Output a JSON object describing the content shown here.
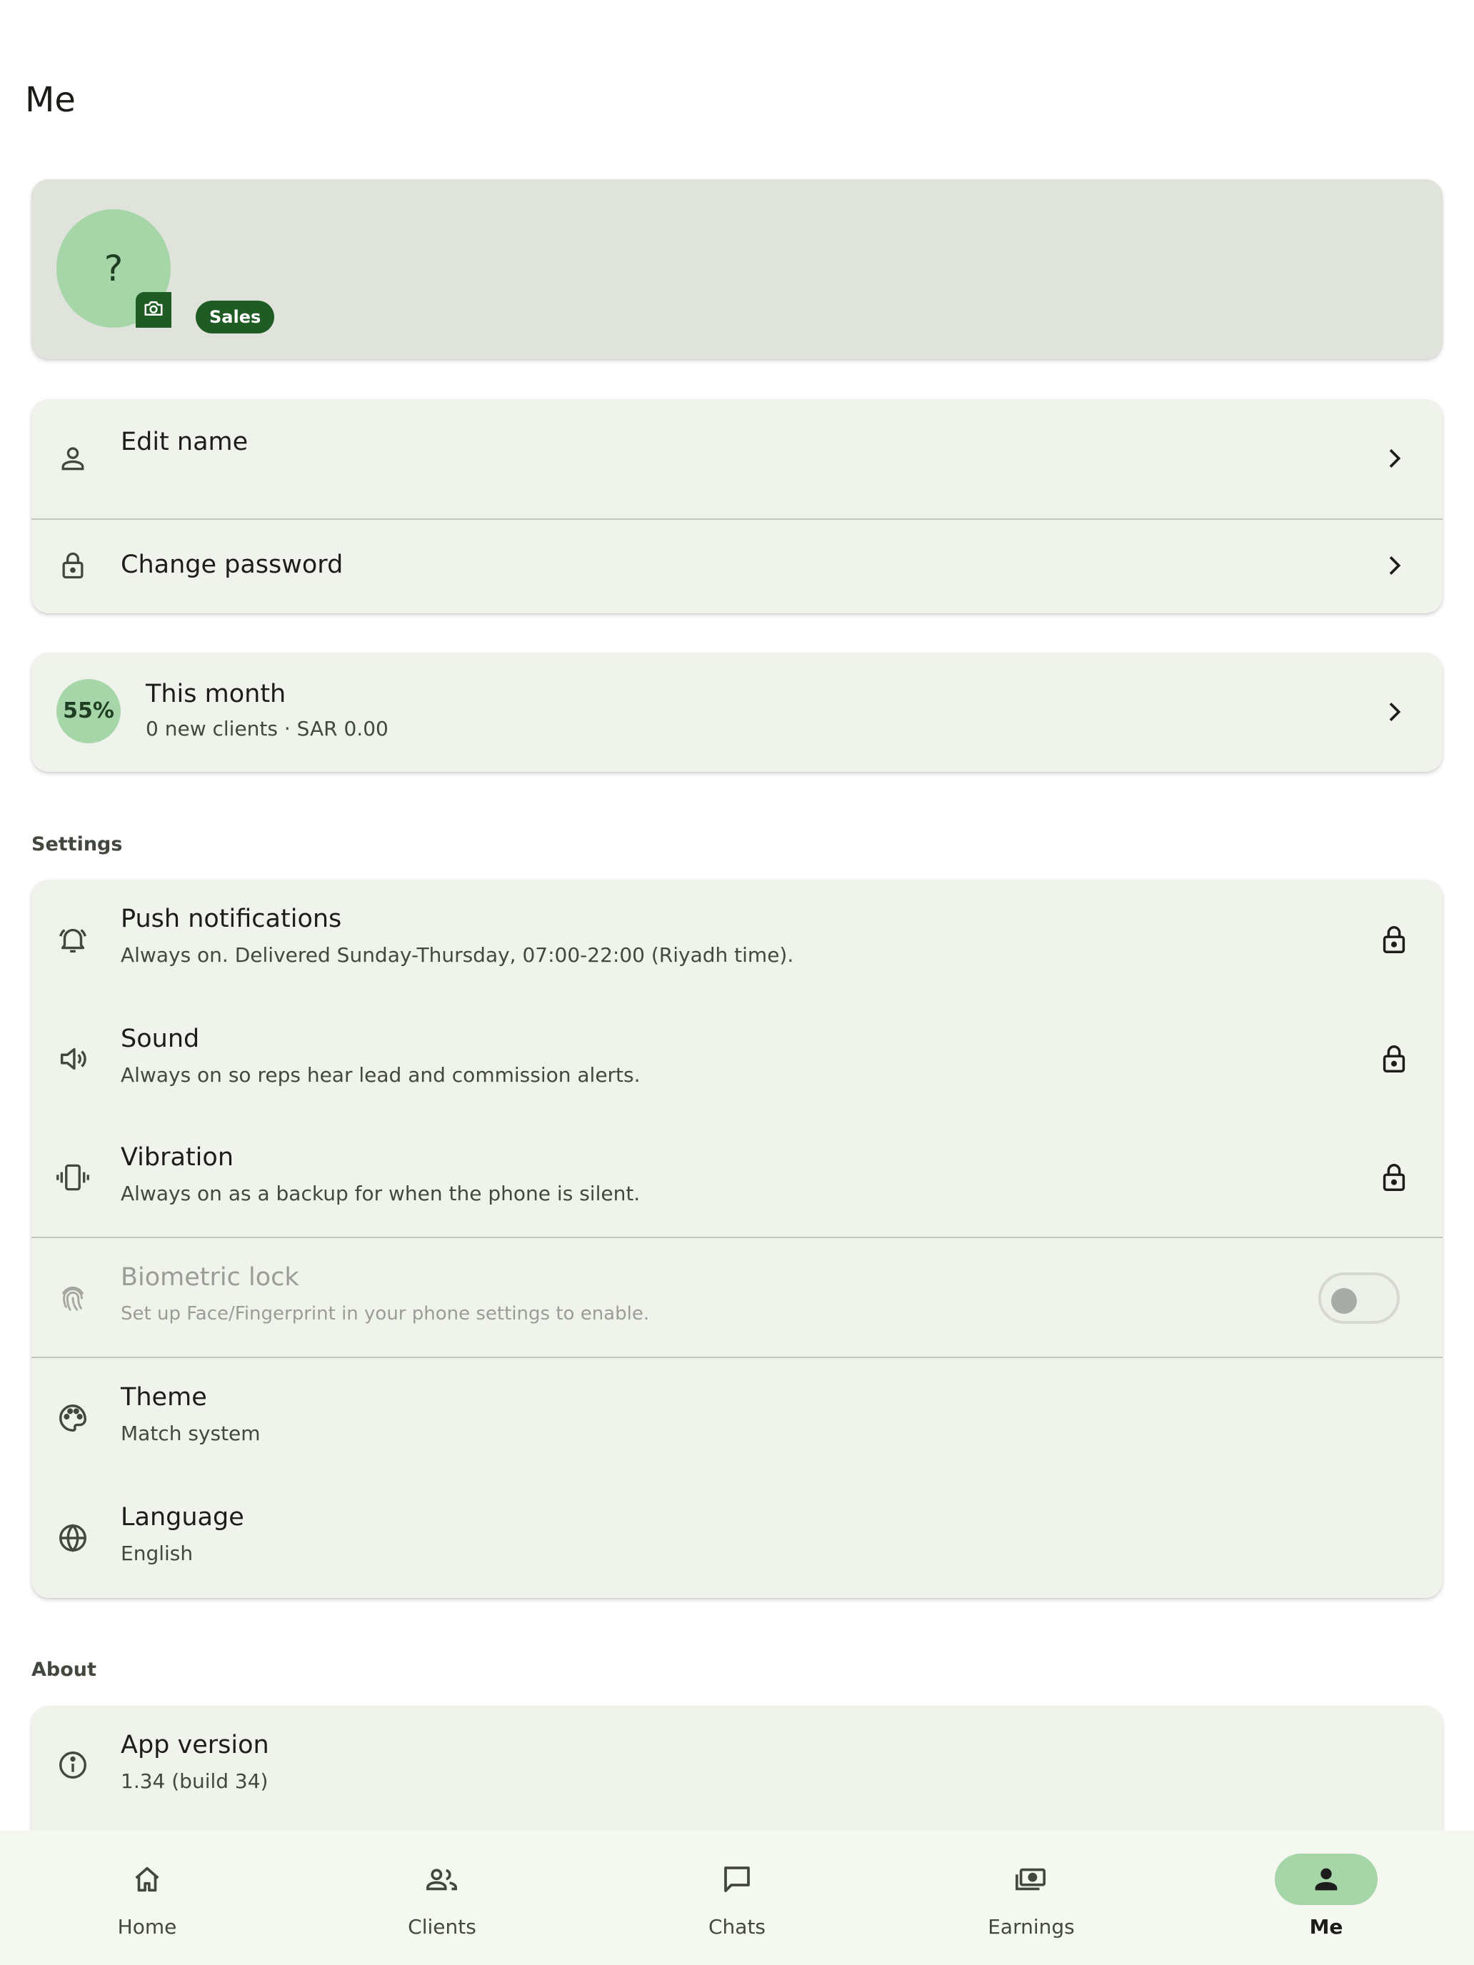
{
  "page": {
    "title": "Me"
  },
  "profile": {
    "avatar_initial": "?",
    "role_badge": "Sales"
  },
  "account": {
    "edit_name": "Edit name",
    "change_password": "Change password"
  },
  "stats": {
    "progress_label": "55%",
    "progress_value": 0.55,
    "title": "This month",
    "subtitle": "0 new clients · SAR 0.00"
  },
  "settings": {
    "section_label": "Settings",
    "items": [
      {
        "title": "Push notifications",
        "subtitle": "Always on. Delivered Sunday-Thursday, 07:00-22:00 (Riyadh time).",
        "icon": "bell-icon",
        "trail": "lock-icon"
      },
      {
        "title": "Sound",
        "subtitle": "Always on so reps hear lead and commission alerts.",
        "icon": "speaker-icon",
        "trail": "lock-icon"
      },
      {
        "title": "Vibration",
        "subtitle": "Always on as a backup for when the phone is silent.",
        "icon": "vibration-icon",
        "trail": "lock-icon"
      },
      {
        "title": "Biometric lock",
        "subtitle": "Set up Face/Fingerprint in your phone settings to enable.",
        "icon": "fingerprint-icon",
        "toggle_on": false,
        "disabled": true
      },
      {
        "title": "Theme",
        "subtitle": "Match system",
        "icon": "palette-icon"
      },
      {
        "title": "Language",
        "subtitle": "English",
        "icon": "globe-icon"
      }
    ]
  },
  "about": {
    "section_label": "About",
    "app_version_title": "App version",
    "app_version_value": "1.34 (build 34)"
  },
  "bottom_nav": {
    "items": [
      {
        "label": "Home",
        "icon": "home-icon",
        "active": false
      },
      {
        "label": "Clients",
        "icon": "clients-icon",
        "active": false
      },
      {
        "label": "Chats",
        "icon": "chat-icon",
        "active": false
      },
      {
        "label": "Earnings",
        "icon": "earnings-icon",
        "active": false
      },
      {
        "label": "Me",
        "icon": "person-icon",
        "active": true
      }
    ]
  },
  "colors": {
    "accent_dark": "#1f5c24",
    "accent_light": "#a6d5a8",
    "card_bg": "#f0f3ec",
    "profile_bg": "#dfe3db"
  }
}
